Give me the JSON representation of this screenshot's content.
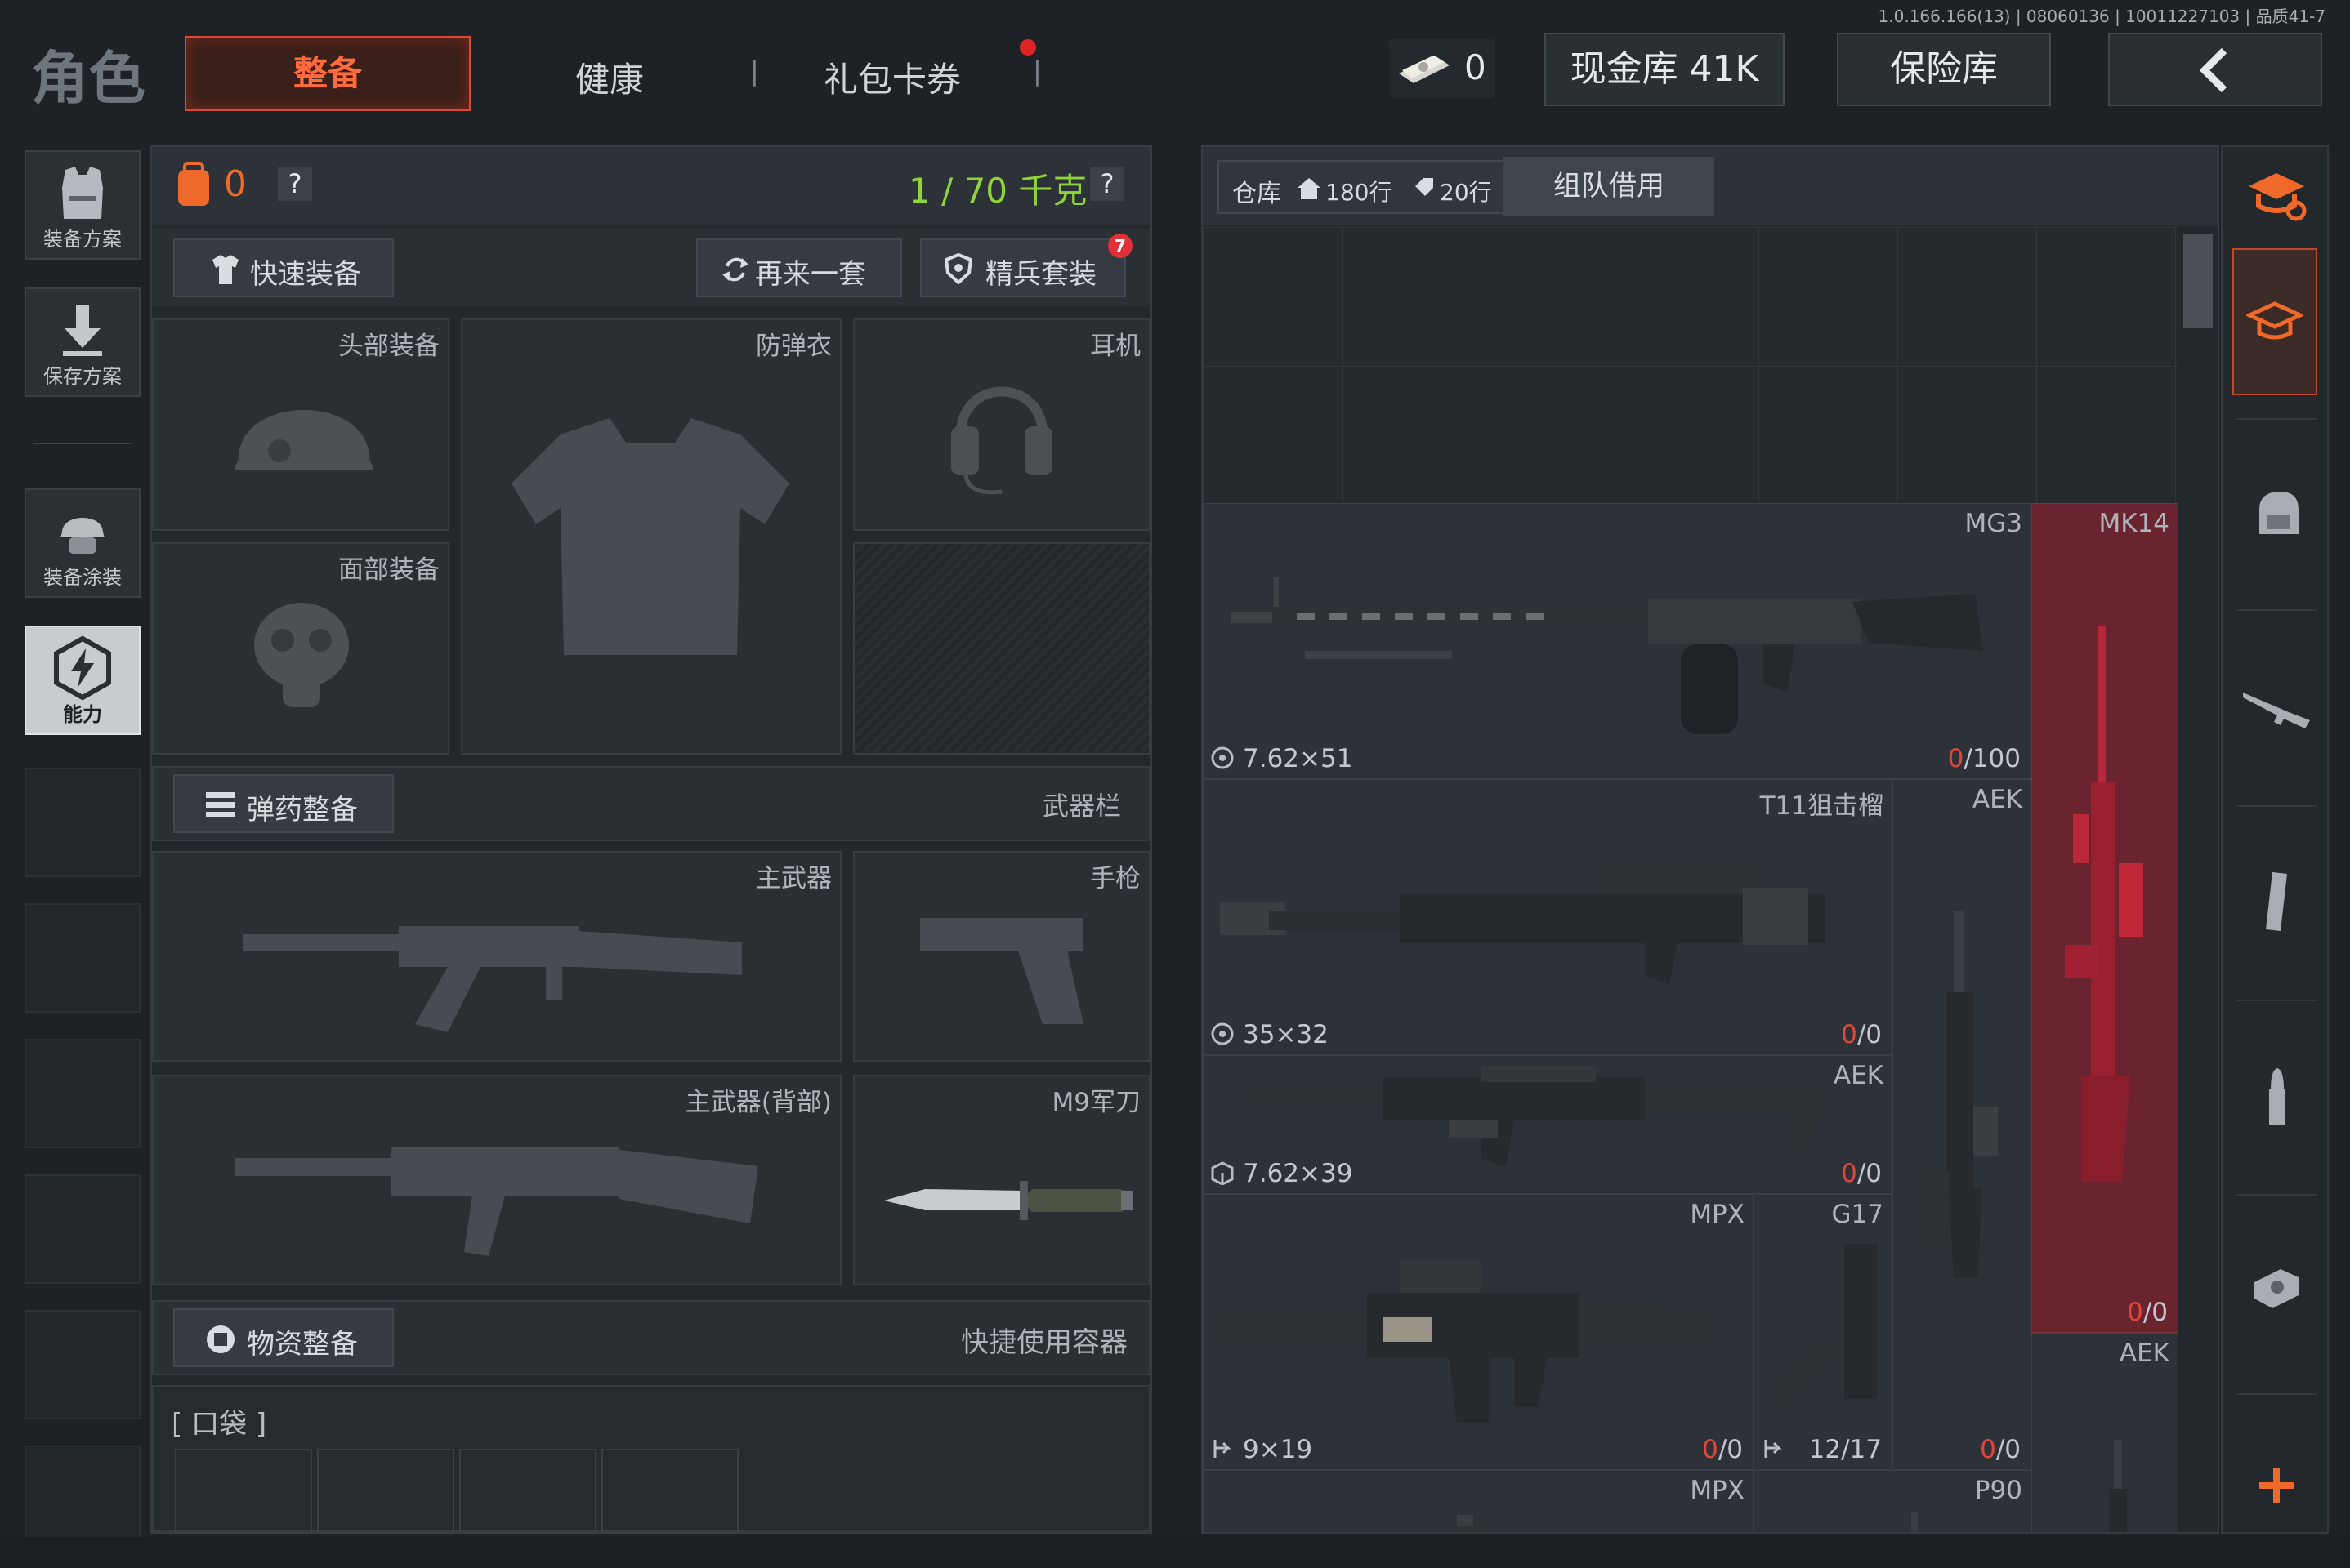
{
  "version_text": "1.0.166.166(13) | 08060136 | 10011227103 | 品质41-7",
  "top": {
    "title": "角色",
    "tabs": [
      "整备",
      "健康",
      "礼包卡券"
    ],
    "separator": "|",
    "currency_value": "0",
    "cash_vault": "现金库 41K",
    "insurance": "保险库",
    "back_icon": "chevron-left-icon"
  },
  "left_sidebar": {
    "items": [
      {
        "label": "装备方案",
        "icon": "vest-icon"
      },
      {
        "label": "保存方案",
        "icon": "download-icon"
      },
      {
        "label": "装备涂装",
        "icon": "helmet-icon"
      },
      {
        "label": "能力",
        "icon": "lightning-hex-icon"
      }
    ]
  },
  "loadout": {
    "backpack_count": "0",
    "help": "?",
    "weight": "1 / 70 千克",
    "quick_equip": "快速装备",
    "reroll": "再来一套",
    "elite_set": "精兵套装",
    "elite_badge": "7",
    "slots": {
      "head": "头部装备",
      "armor": "防弹衣",
      "earphone": "耳机",
      "face": "面部装备"
    },
    "ammo_section": "弹药整备",
    "weapon_bar": "武器栏",
    "weapon_slots": {
      "primary": "主武器",
      "pistol": "手枪",
      "primary_back": "主武器(背部)",
      "knife": "M9军刀"
    },
    "supply_section": "物资整备",
    "quick_container": "快捷使用容器",
    "pocket": "[ 口袋 ]"
  },
  "warehouse": {
    "tab_warehouse_prefix": "仓库",
    "rows_home": "180行",
    "rows_tag": "20行",
    "tab_team": "组队借用",
    "items": [
      {
        "name": "MG3",
        "ammo": "7.62×51",
        "count_a": "0",
        "count_b": "/100"
      },
      {
        "name": "MK14",
        "count_a": "0",
        "count_b": "/0"
      },
      {
        "name": "T11狙击榴",
        "ammo": "35×32",
        "count_a": "0",
        "count_b": "/0"
      },
      {
        "name": "AEK",
        "count_a": "0",
        "count_b": "/0"
      },
      {
        "name": "AEK",
        "ammo": "7.62×39",
        "count_a": "0",
        "count_b": "/0"
      },
      {
        "name": "MPX",
        "ammo": "9×19",
        "count_a": "0",
        "count_b": "/0"
      },
      {
        "name": "G17",
        "ammo_count": "12/17"
      },
      {
        "name": "AEK"
      },
      {
        "name": "MPX"
      },
      {
        "name": "P90"
      }
    ]
  },
  "right_sidebar": {
    "icons": [
      "cap-swap-icon",
      "cap-icon",
      "backpack-icon",
      "rifle-icon",
      "magazine-icon",
      "bullet-icon",
      "scope-icon",
      "plus-icon"
    ]
  },
  "colors": {
    "accent_orange": "#e0472c",
    "weight_green": "#8fd43a",
    "red_highlight": "#6a2430",
    "count_red": "#e0473a"
  }
}
